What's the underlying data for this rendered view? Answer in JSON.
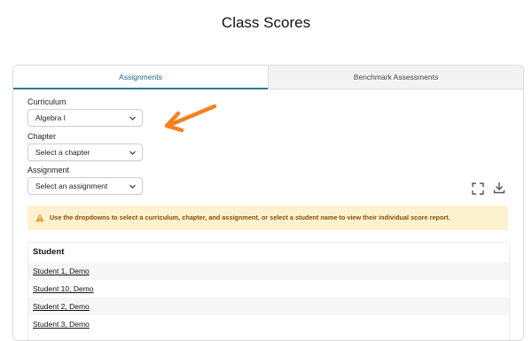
{
  "page": {
    "title": "Class Scores"
  },
  "tabs": [
    {
      "label": "Assignments",
      "active": true
    },
    {
      "label": "Benchmark Assessments",
      "active": false
    }
  ],
  "filters": {
    "curriculum": {
      "label": "Curriculum",
      "value": "Algebra I"
    },
    "chapter": {
      "label": "Chapter",
      "value": "Select a chapter"
    },
    "assignment": {
      "label": "Assignment",
      "value": "Select an assignment"
    }
  },
  "toolbar": {
    "fullscreen_icon": "fullscreen-icon",
    "download_icon": "download-icon"
  },
  "alert": {
    "icon": "warning-icon",
    "message": "Use the dropdowns to select a curriculum, chapter, and assignment, or select a student name to view their individual score report."
  },
  "table": {
    "header": "Student",
    "rows": [
      "Student 1, Demo",
      "Student 10, Demo",
      "Student 2, Demo",
      "Student 3, Demo"
    ]
  },
  "colors": {
    "accent": "#2a7a93",
    "alert_bg": "#fdf2cf",
    "alert_text": "#8a4b06",
    "annotation_arrow": "#f5821f"
  }
}
